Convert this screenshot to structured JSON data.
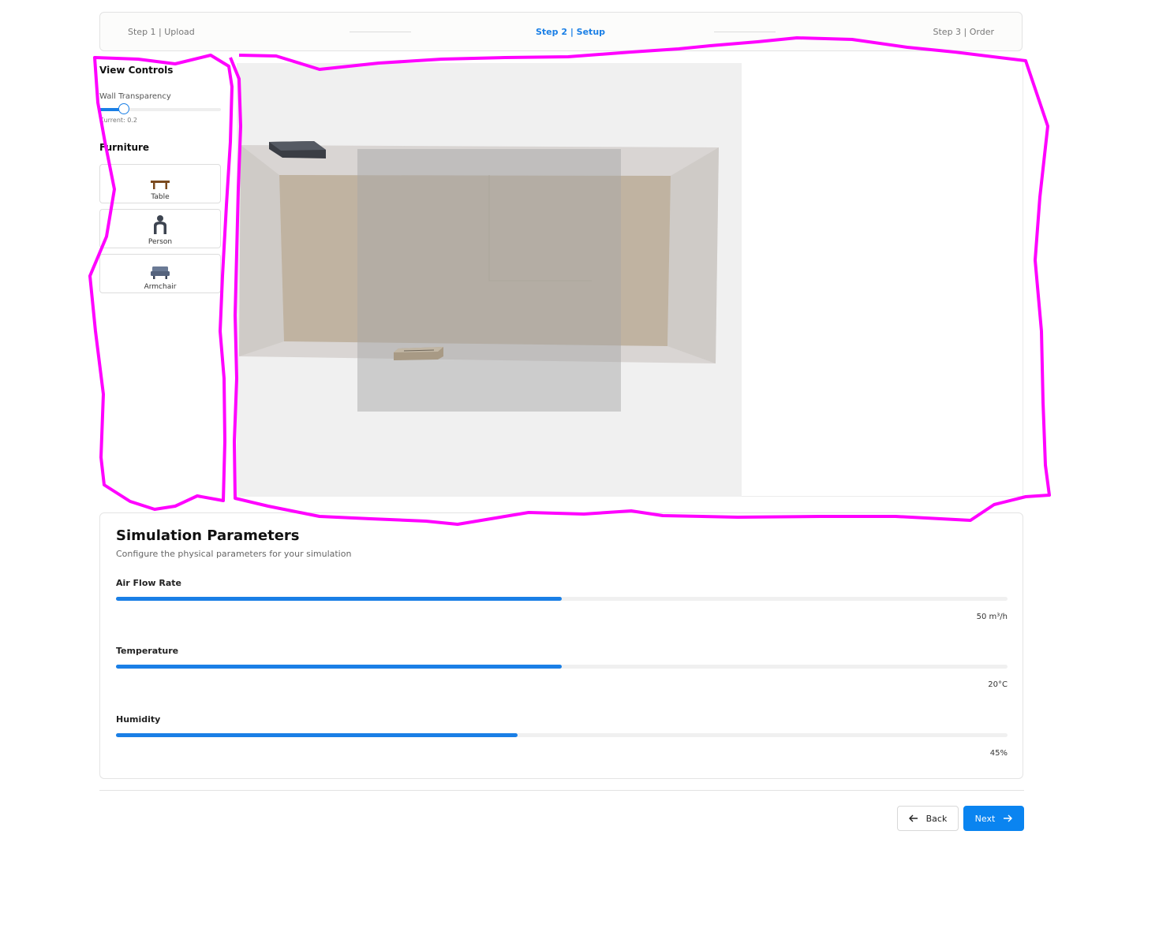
{
  "stepper": {
    "steps": [
      {
        "label": "Step 1 | Upload",
        "state": "done"
      },
      {
        "label": "Step 2 | Setup",
        "state": "active"
      },
      {
        "label": "Step 3 | Order",
        "state": "pending"
      }
    ]
  },
  "sidebar": {
    "view_controls_title": "View Controls",
    "wall_transparency_label": "Wall Transparency",
    "wall_transparency_value": 0.2,
    "wall_transparency_current": "Current: 0.2",
    "furniture_title": "Furniture",
    "furniture": [
      {
        "label": "Table",
        "icon": "table-icon"
      },
      {
        "label": "Person",
        "icon": "person-icon"
      },
      {
        "label": "Armchair",
        "icon": "armchair-icon"
      }
    ]
  },
  "viewer": {
    "description_icons": [
      "ceiling-vent-icon",
      "floor-vent-icon"
    ]
  },
  "params": {
    "title": "Simulation Parameters",
    "subtitle": "Configure the physical parameters for your simulation",
    "items": [
      {
        "label": "Air Flow Rate",
        "value": "50 m³/h",
        "fraction": 0.5
      },
      {
        "label": "Temperature",
        "value": "20°C",
        "fraction": 0.5
      },
      {
        "label": "Humidity",
        "value": "45%",
        "fraction": 0.45
      }
    ]
  },
  "nav": {
    "back_label": "Back",
    "next_label": "Next"
  },
  "colors": {
    "accent": "#1a7fe6",
    "annotation": "#ff00ff",
    "wall": "#d9d6d4",
    "floor": "#b9ab98"
  }
}
